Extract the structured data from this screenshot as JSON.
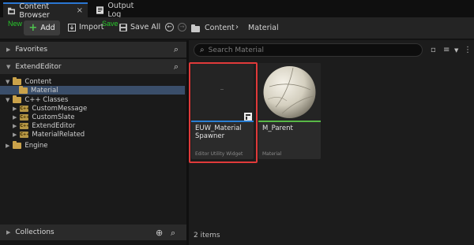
{
  "tabs": [
    {
      "label": "Content Browser",
      "close": "×"
    },
    {
      "label": "Output Log"
    }
  ],
  "annotations": {
    "new": "New",
    "save": "Save"
  },
  "toolbar": {
    "add_label": "Add",
    "import_label": "Import",
    "save_all_label": "Save All",
    "breadcrumb": [
      "Content",
      "Material"
    ]
  },
  "left_panel": {
    "favorites_label": "Favorites",
    "project_label": "ExtendEditor",
    "tree": {
      "content": "Content",
      "material": "Material",
      "cpp_classes": "C++ Classes",
      "modules": [
        "CustomMessage",
        "CustomSlate",
        "ExtendEditor",
        "MaterialRelated"
      ],
      "engine": "Engine"
    },
    "collections_label": "Collections"
  },
  "search": {
    "placeholder": "Search Material"
  },
  "assets": [
    {
      "name": "EUW_Material Spawner",
      "type": "Editor Utility Widget",
      "bar_color": "#2a7fd4",
      "selected": true
    },
    {
      "name": "M_Parent",
      "type": "Material",
      "bar_color": "#58b847",
      "selected": false
    }
  ],
  "item_count": "2 items",
  "colors": {
    "accent": "#2a76d2",
    "highlight": "#e03a3a",
    "green_label": "#29c72c"
  }
}
